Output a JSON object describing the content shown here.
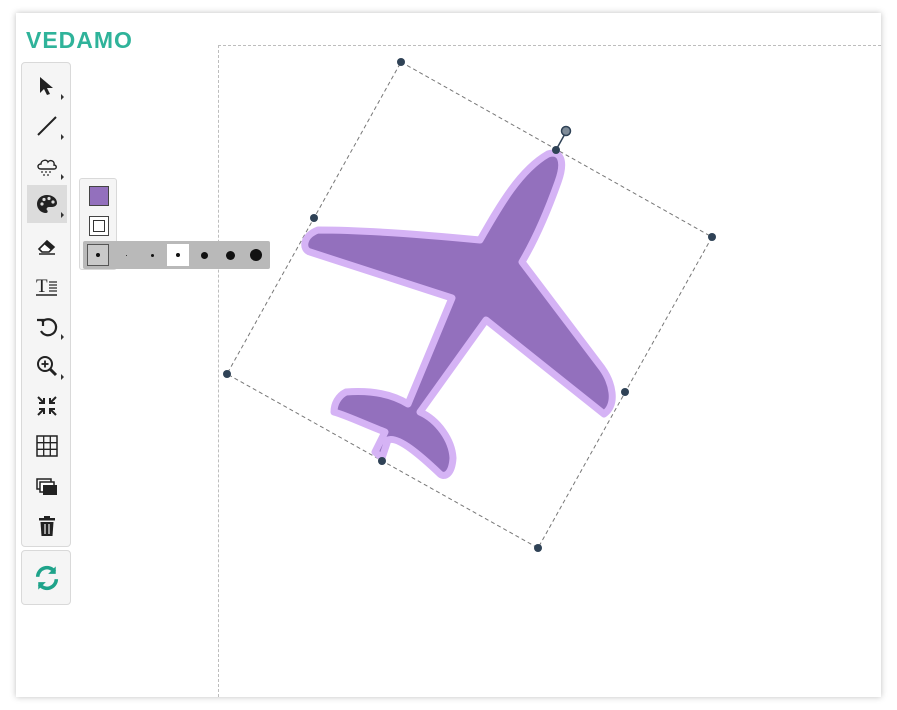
{
  "app": {
    "logo": "VEDAMO"
  },
  "colors": {
    "brand": "#2fb39a",
    "fill": "#9370bd",
    "stroke": "#d5b3f5",
    "handle": "#2f4256",
    "toolbar_bg": "#f5f5f5"
  },
  "toolbar": {
    "tools": [
      {
        "name": "select-tool",
        "icon": "cursor-arrow-icon",
        "has_submenu": true
      },
      {
        "name": "line-tool",
        "icon": "line-icon",
        "has_submenu": true
      },
      {
        "name": "shapes-tool",
        "icon": "cloud-shape-icon",
        "has_submenu": true
      },
      {
        "name": "color-tool",
        "icon": "palette-icon",
        "has_submenu": true,
        "active": true
      },
      {
        "name": "eraser-tool",
        "icon": "eraser-icon",
        "has_submenu": false
      },
      {
        "name": "text-tool",
        "icon": "text-icon",
        "has_submenu": false
      },
      {
        "name": "undo-tool",
        "icon": "undo-icon",
        "has_submenu": true
      },
      {
        "name": "zoom-tool",
        "icon": "zoom-in-icon",
        "has_submenu": true
      },
      {
        "name": "fit-tool",
        "icon": "shrink-arrows-icon",
        "has_submenu": false
      },
      {
        "name": "grid-tool",
        "icon": "grid-icon",
        "has_submenu": false
      },
      {
        "name": "layers-tool",
        "icon": "layers-icon",
        "has_submenu": false
      },
      {
        "name": "delete-tool",
        "icon": "trash-icon",
        "has_submenu": false
      }
    ],
    "sync": {
      "icon": "sync-icon"
    }
  },
  "color_panel": {
    "fill_color": "#9370bd",
    "stroke_color": "#ffffff",
    "stroke_sizes": [
      {
        "size": 3,
        "state": "current"
      },
      {
        "size": 1
      },
      {
        "size": 2
      },
      {
        "size": 3,
        "state": "selected"
      },
      {
        "size": 5
      },
      {
        "size": 7
      },
      {
        "size": 9
      }
    ]
  }
}
